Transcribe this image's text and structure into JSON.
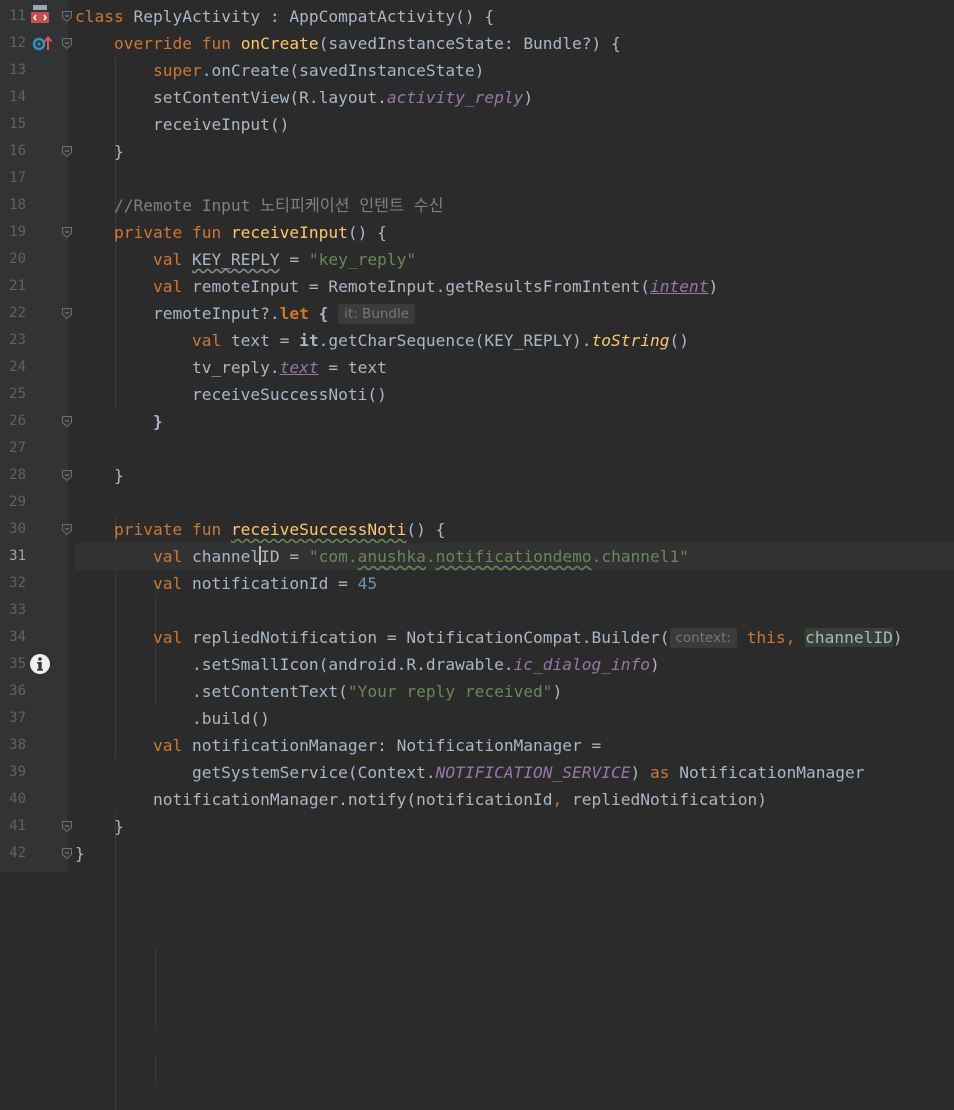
{
  "lines": [
    {
      "n": "11",
      "segs": [
        {
          "t": "class ",
          "c": "kw"
        },
        {
          "t": "ReplyActivity : AppCompatActivity() {"
        }
      ]
    },
    {
      "n": "12",
      "segs": [
        {
          "t": "    "
        },
        {
          "t": "override fun ",
          "c": "kw"
        },
        {
          "t": "onCreate",
          "c": "fn"
        },
        {
          "t": "(savedInstanceState: Bundle?) {"
        }
      ]
    },
    {
      "n": "13",
      "segs": [
        {
          "t": "        "
        },
        {
          "t": "super",
          "c": "kw"
        },
        {
          "t": ".onCreate(savedInstanceState)"
        }
      ]
    },
    {
      "n": "14",
      "segs": [
        {
          "t": "        setContentView(R.layout."
        },
        {
          "t": "activity_reply",
          "c": "ital-purple"
        },
        {
          "t": ")"
        }
      ]
    },
    {
      "n": "15",
      "segs": [
        {
          "t": "        receiveInput()"
        }
      ]
    },
    {
      "n": "16",
      "segs": [
        {
          "t": "    }"
        }
      ]
    },
    {
      "n": "17",
      "segs": []
    },
    {
      "n": "18",
      "segs": [
        {
          "t": "    "
        },
        {
          "t": "//Remote Input 노티피케이션 인텐트 수신",
          "c": "cmt"
        }
      ]
    },
    {
      "n": "19",
      "segs": [
        {
          "t": "    "
        },
        {
          "t": "private fun ",
          "c": "kw"
        },
        {
          "t": "receiveInput",
          "c": "fn"
        },
        {
          "t": "() {"
        }
      ]
    },
    {
      "n": "20",
      "segs": [
        {
          "t": "        "
        },
        {
          "t": "val ",
          "c": "kw"
        },
        {
          "t": "KEY_REPLY",
          "c": "wavy-gray"
        },
        {
          "t": " = "
        },
        {
          "t": "\"key_reply\"",
          "c": "str"
        }
      ]
    },
    {
      "n": "21",
      "segs": [
        {
          "t": "        "
        },
        {
          "t": "val ",
          "c": "kw"
        },
        {
          "t": "remoteInput = RemoteInput.getResultsFromIntent("
        },
        {
          "t": "intent",
          "c": "ital-purple under"
        },
        {
          "t": ")"
        }
      ]
    },
    {
      "n": "22",
      "segs": [
        {
          "t": "        remoteInput?."
        },
        {
          "t": "let",
          "c": "kw bold"
        },
        {
          "t": " {",
          "c": "bold"
        },
        {
          "t": " "
        },
        {
          "t": "it: Bundle",
          "c": "hint"
        }
      ]
    },
    {
      "n": "23",
      "segs": [
        {
          "t": "            "
        },
        {
          "t": "val ",
          "c": "kw"
        },
        {
          "t": "text = "
        },
        {
          "t": "it",
          "c": "bold"
        },
        {
          "t": ".getCharSequence(KEY_REPLY)."
        },
        {
          "t": "toString",
          "c": "ital-fn"
        },
        {
          "t": "()"
        }
      ]
    },
    {
      "n": "24",
      "segs": [
        {
          "t": "            tv_reply."
        },
        {
          "t": "text",
          "c": "ital-purple under"
        },
        {
          "t": " = text"
        }
      ]
    },
    {
      "n": "25",
      "segs": [
        {
          "t": "            receiveSuccessNoti()"
        }
      ]
    },
    {
      "n": "26",
      "segs": [
        {
          "t": "        "
        },
        {
          "t": "}",
          "c": "bold"
        }
      ]
    },
    {
      "n": "27",
      "segs": []
    },
    {
      "n": "28",
      "segs": [
        {
          "t": "    }"
        }
      ]
    },
    {
      "n": "29",
      "segs": []
    },
    {
      "n": "30",
      "segs": [
        {
          "t": "    "
        },
        {
          "t": "private fun ",
          "c": "kw"
        },
        {
          "t": "receiveSuccessNoti",
          "c": "fn wavy"
        },
        {
          "t": "() {"
        }
      ]
    },
    {
      "n": "31",
      "current": true,
      "segs": [
        {
          "t": "        "
        },
        {
          "t": "val ",
          "c": "kw"
        },
        {
          "t": "channel"
        },
        {
          "t": "",
          "c": "caret"
        },
        {
          "t": "ID = "
        },
        {
          "t": "\"com.",
          "c": "str"
        },
        {
          "t": "anushka",
          "c": "str wavy"
        },
        {
          "t": ".",
          "c": "str"
        },
        {
          "t": "notificationdemo",
          "c": "str wavy"
        },
        {
          "t": ".channel1\"",
          "c": "str"
        }
      ]
    },
    {
      "n": "32",
      "segs": [
        {
          "t": "        "
        },
        {
          "t": "val ",
          "c": "kw"
        },
        {
          "t": "notificationId = "
        },
        {
          "t": "45",
          "c": "num"
        }
      ]
    },
    {
      "n": "33",
      "segs": []
    },
    {
      "n": "34",
      "segs": [
        {
          "t": "        "
        },
        {
          "t": "val ",
          "c": "kw"
        },
        {
          "t": "repliedNotification = NotificationCompat.Builder("
        },
        {
          "t": "context:",
          "c": "hint"
        },
        {
          "t": " "
        },
        {
          "t": "this",
          "c": "kw"
        },
        {
          "t": ", ",
          "c": "kw"
        },
        {
          "t": "channelID",
          "c": "hl-box"
        },
        {
          "t": ")"
        }
      ]
    },
    {
      "n": "35",
      "segs": [
        {
          "t": "            .setSmallIcon(android.R.drawable."
        },
        {
          "t": "ic_dialog_info",
          "c": "ital-purple"
        },
        {
          "t": ")"
        }
      ]
    },
    {
      "n": "36",
      "segs": [
        {
          "t": "            .setContentText("
        },
        {
          "t": "\"Your reply received\"",
          "c": "str"
        },
        {
          "t": ")"
        }
      ]
    },
    {
      "n": "37",
      "segs": [
        {
          "t": "            .build()"
        }
      ]
    },
    {
      "n": "38",
      "segs": [
        {
          "t": "        "
        },
        {
          "t": "val ",
          "c": "kw"
        },
        {
          "t": "notificationManager: NotificationManager ="
        }
      ]
    },
    {
      "n": "39",
      "segs": [
        {
          "t": "            getSystemService(Context."
        },
        {
          "t": "NOTIFICATION_SERVICE",
          "c": "ital-purple"
        },
        {
          "t": ") "
        },
        {
          "t": "as ",
          "c": "kw"
        },
        {
          "t": "NotificationManager"
        }
      ]
    },
    {
      "n": "40",
      "segs": [
        {
          "t": "        notificationManager.notify(notificationId"
        },
        {
          "t": ", ",
          "c": "kw"
        },
        {
          "t": "repliedNotification)"
        }
      ]
    },
    {
      "n": "41",
      "segs": [
        {
          "t": "    }"
        }
      ]
    },
    {
      "n": "42",
      "segs": [
        {
          "t": "}"
        }
      ]
    }
  ],
  "folds": [
    "11",
    "12",
    "16",
    "19",
    "22",
    "26",
    "28",
    "30",
    "41",
    "42"
  ],
  "gutter_icons": {
    "11": "kotlin-class-icon",
    "12": "override-method-icon",
    "31": "lightbulb-icon",
    "35": "info-icon"
  },
  "colors": {
    "background": "#2b2b2b",
    "gutter": "#313335",
    "keyword": "#cc7832",
    "function": "#ffc66d",
    "string": "#6a8759",
    "number": "#6897bb",
    "comment": "#808080",
    "field": "#9876aa"
  }
}
